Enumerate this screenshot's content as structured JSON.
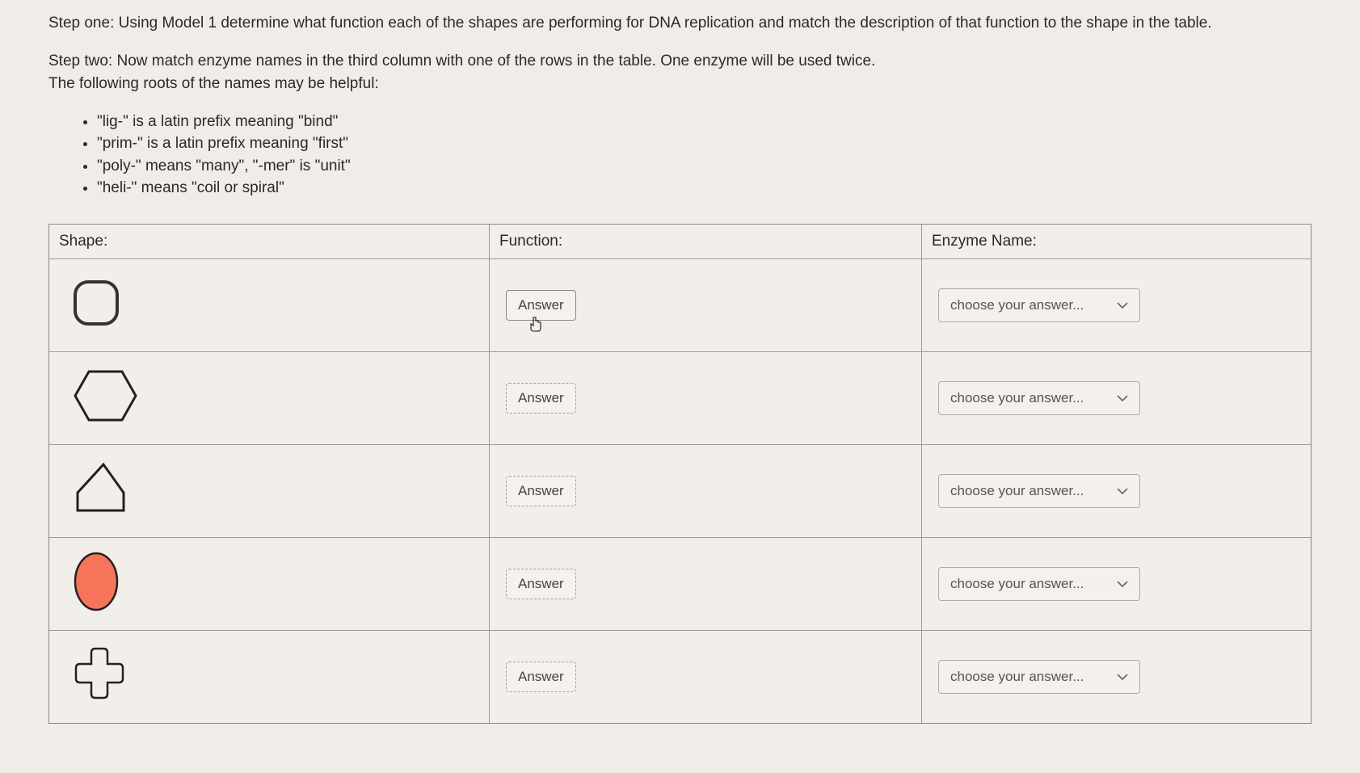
{
  "instructions": {
    "step1": "Step one: Using Model 1 determine what function each of the shapes are performing for DNA replication and match the description of that function to the shape in the table.",
    "step2a": "Step two: Now match enzyme names in the third column with one of the rows in the table. One enzyme will be used twice.",
    "step2b": "The following roots of the names may be helpful:"
  },
  "hints": [
    "\"lig-\" is a latin prefix meaning \"bind\"",
    "\"prim-\" is a latin prefix meaning \"first\"",
    "\"poly-\" means \"many\", \"-mer\" is \"unit\"",
    "\"heli-\" means \"coil or spiral\""
  ],
  "table": {
    "headers": {
      "shape": "Shape:",
      "function": "Function:",
      "enzyme": "Enzyme Name:"
    },
    "rows": [
      {
        "answer_label": "Answer",
        "select_label": "choose your answer..."
      },
      {
        "answer_label": "Answer",
        "select_label": "choose your answer..."
      },
      {
        "answer_label": "Answer",
        "select_label": "choose your answer..."
      },
      {
        "answer_label": "Answer",
        "select_label": "choose your answer..."
      },
      {
        "answer_label": "Answer",
        "select_label": "choose your answer..."
      }
    ]
  }
}
